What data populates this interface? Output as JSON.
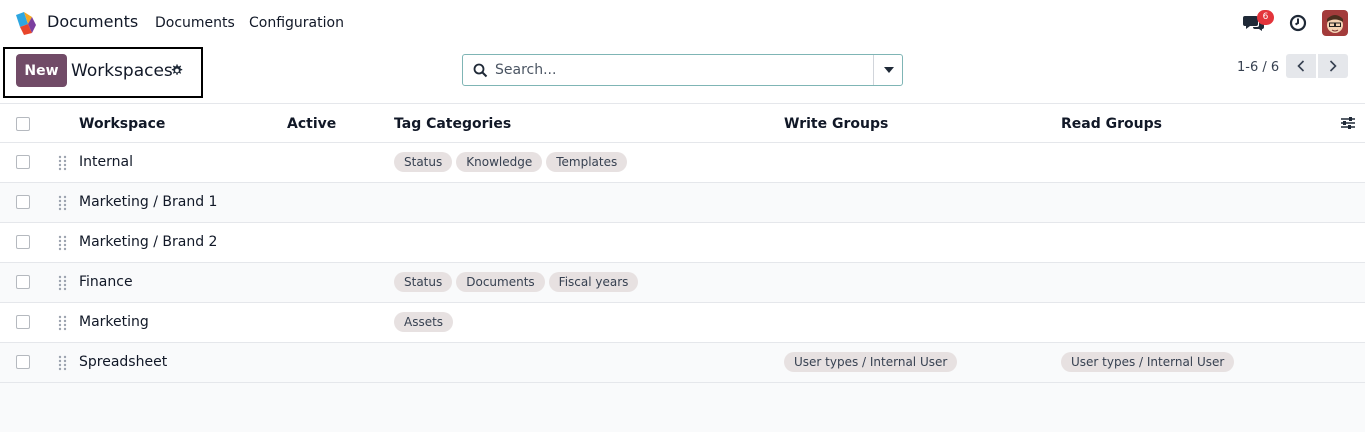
{
  "app": {
    "name": "Documents"
  },
  "menu": {
    "documents": "Documents",
    "configuration": "Configuration"
  },
  "systray": {
    "chat_badge": "6"
  },
  "control": {
    "new_label": "New",
    "title": "Workspaces"
  },
  "search": {
    "placeholder": "Search..."
  },
  "pager": {
    "value": "1-6 / 6"
  },
  "columns": {
    "workspace": "Workspace",
    "active": "Active",
    "tag_categories": "Tag Categories",
    "write_groups": "Write Groups",
    "read_groups": "Read Groups"
  },
  "rows": [
    {
      "name": "Internal",
      "tags": [
        "Status",
        "Knowledge",
        "Templates"
      ]
    },
    {
      "name": "Marketing / Brand 1",
      "tags": []
    },
    {
      "name": "Marketing / Brand 2",
      "tags": []
    },
    {
      "name": "Finance",
      "tags": [
        "Status",
        "Documents",
        "Fiscal years"
      ]
    },
    {
      "name": "Marketing",
      "tags": [
        "Assets"
      ]
    },
    {
      "name": "Spreadsheet",
      "tags": [],
      "write_groups": "User types / Internal User",
      "read_groups": "User types / Internal User"
    }
  ],
  "colors": {
    "primary": "#714b67",
    "badge": "#e3343b",
    "tag_bg": "#e7e1e1"
  },
  "icons": [
    "app-logo",
    "chat-icon",
    "clock-icon",
    "gear-icon",
    "search-icon",
    "caret-down-icon",
    "chevron-left-icon",
    "chevron-right-icon",
    "drag-handle-icon",
    "column-options-icon"
  ]
}
